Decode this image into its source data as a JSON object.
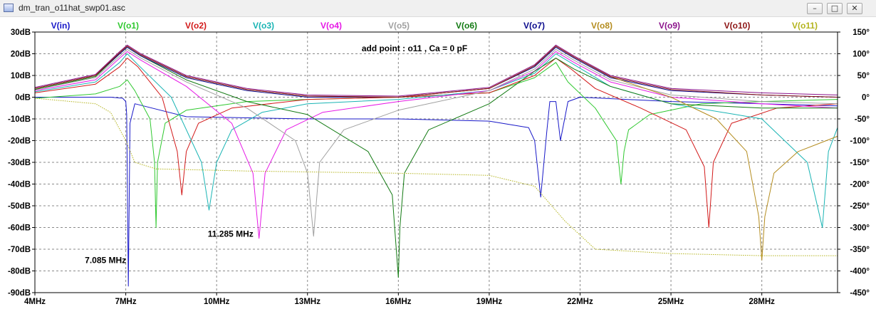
{
  "window": {
    "title": "dm_tran_o11hat_swp01.asc",
    "minimize_glyph": "–",
    "maximize_glyph": "□",
    "close_glyph": "✕"
  },
  "chart_data": {
    "type": "line",
    "annotation_title": "add point : o11 , Ca = 0 pF",
    "annotations": [
      {
        "text": "7.085 MHz",
        "x": 7.085,
        "y": -75
      },
      {
        "text": "11.285 MHz",
        "x": 11.285,
        "y": -63
      }
    ],
    "x_axis": {
      "min": 4,
      "max": 30.5,
      "unit": "MHz",
      "ticks": [
        4,
        7,
        10,
        13,
        16,
        19,
        22,
        25,
        28
      ],
      "tick_labels": [
        "4MHz",
        "7MHz",
        "10MHz",
        "13MHz",
        "16MHz",
        "19MHz",
        "22MHz",
        "25MHz",
        "28MHz"
      ]
    },
    "y_axis_left": {
      "min": -90,
      "max": 30,
      "unit": "dB",
      "ticks": [
        30,
        20,
        10,
        0,
        -10,
        -20,
        -30,
        -40,
        -50,
        -60,
        -70,
        -80,
        -90
      ],
      "tick_labels": [
        "30dB",
        "20dB",
        "10dB",
        "0dB",
        "-10dB",
        "-20dB",
        "-30dB",
        "-40dB",
        "-50dB",
        "-60dB",
        "-70dB",
        "-80dB",
        "-90dB"
      ]
    },
    "y_axis_right": {
      "min": -450,
      "max": 150,
      "unit": "°",
      "ticks": [
        150,
        100,
        50,
        0,
        -50,
        -100,
        -150,
        -200,
        -250,
        -300,
        -350,
        -400,
        -450
      ],
      "tick_labels": [
        "150°",
        "100°",
        "50°",
        "0°",
        "-50°",
        "-100°",
        "-150°",
        "-200°",
        "-250°",
        "-300°",
        "-350°",
        "-400°",
        "-450°"
      ]
    },
    "grid": true,
    "series": [
      {
        "name": "V(in)",
        "color": "#1818c8",
        "x": [
          4,
          6.5,
          6.9,
          7.0,
          7.03,
          7.085,
          7.14,
          7.3,
          9,
          13,
          16,
          19,
          20.3,
          20.5,
          20.7,
          20.9,
          21.0,
          21.2,
          21.35,
          21.6,
          22,
          25,
          28,
          30.5
        ],
        "y": [
          0,
          0,
          -0.5,
          -2,
          -8,
          -87,
          -12,
          -3,
          -9,
          -10,
          -10,
          -11,
          -14,
          -20,
          -46,
          -16,
          -2,
          -2,
          -20,
          -2,
          0,
          -2,
          -3,
          -4
        ]
      },
      {
        "name": "V(o1)",
        "color": "#2fc82f",
        "x": [
          4,
          6,
          6.8,
          7.05,
          7.3,
          7.8,
          7.95,
          8.0,
          8.05,
          8.3,
          9,
          11,
          13,
          16,
          19,
          20.5,
          21.2,
          21.6,
          22.5,
          23.2,
          23.35,
          23.45,
          23.6,
          24.3,
          26,
          28,
          30.5
        ],
        "y": [
          -0.5,
          1.5,
          5,
          8,
          3,
          -10,
          -30,
          -60,
          -30,
          -12,
          -6,
          -2,
          -1,
          0,
          2,
          9,
          16,
          7,
          -5,
          -20,
          -40,
          -25,
          -15,
          -8,
          -3,
          -2,
          -1
        ]
      },
      {
        "name": "V(o2)",
        "color": "#d21919",
        "x": [
          4,
          6,
          6.8,
          7.05,
          7.4,
          8.2,
          8.7,
          8.85,
          9.0,
          9.4,
          10.5,
          13,
          16,
          19,
          20.5,
          21.2,
          21.7,
          22.5,
          24,
          25.5,
          26.1,
          26.25,
          26.4,
          27,
          28.5,
          30.5
        ],
        "y": [
          2,
          6,
          14,
          18,
          14,
          0,
          -25,
          -45,
          -25,
          -12,
          -5,
          -1,
          0,
          2,
          10,
          18,
          13,
          4,
          -5,
          -15,
          -32,
          -60,
          -30,
          -12,
          -5,
          -3
        ]
      },
      {
        "name": "V(o3)",
        "color": "#19b4b4",
        "x": [
          4,
          6,
          6.8,
          7.05,
          7.4,
          8.5,
          9.5,
          9.75,
          10.0,
          10.5,
          11.5,
          13,
          16,
          19,
          20.5,
          21.2,
          21.8,
          23,
          25,
          28,
          29.5,
          30.0,
          30.2,
          30.5
        ],
        "y": [
          2.5,
          7,
          16,
          20,
          15,
          0,
          -30,
          -52,
          -30,
          -15,
          -7,
          -3,
          -1,
          3,
          11,
          20,
          15,
          5,
          -3,
          -10,
          -30,
          -60,
          -25,
          -14
        ]
      },
      {
        "name": "V(o4)",
        "color": "#e619e6",
        "x": [
          4,
          6,
          6.8,
          7.05,
          7.5,
          9,
          10.5,
          11.2,
          11.4,
          11.6,
          12.3,
          13.5,
          16,
          19,
          20.5,
          21.2,
          21.8,
          23,
          25,
          28,
          30.5
        ],
        "y": [
          3,
          8,
          18,
          21,
          17,
          5,
          -12,
          -35,
          -65,
          -35,
          -15,
          -7,
          -2,
          3,
          12,
          21,
          16,
          7,
          0,
          -3,
          -5
        ]
      },
      {
        "name": "V(o5)",
        "color": "#a0a0a0",
        "x": [
          4,
          6,
          6.8,
          7.05,
          7.5,
          9,
          11,
          12.6,
          13.0,
          13.2,
          13.4,
          14.2,
          16,
          19,
          20.5,
          21.2,
          21.8,
          23,
          25,
          28,
          30.5
        ],
        "y": [
          3.5,
          9,
          19,
          22,
          18,
          7,
          -5,
          -20,
          -35,
          -64,
          -30,
          -15,
          -6,
          3,
          13,
          22,
          17,
          8,
          1,
          -2,
          -3
        ]
      },
      {
        "name": "V(o6)",
        "color": "#127a12",
        "x": [
          4,
          6,
          6.8,
          7.05,
          7.5,
          9,
          11,
          13,
          15,
          15.8,
          16.0,
          16.05,
          16.2,
          17,
          19,
          20.5,
          21.2,
          21.8,
          23,
          25,
          28,
          30.5
        ],
        "y": [
          3.5,
          9.5,
          20,
          23,
          19,
          8,
          -2,
          -8,
          -25,
          -45,
          -83,
          -60,
          -35,
          -15,
          -3,
          12,
          18,
          13,
          5,
          -3,
          -5,
          -5
        ]
      },
      {
        "name": "V(o7)",
        "color": "#0a0a8c",
        "x": [
          4,
          6,
          6.8,
          7.05,
          7.5,
          9,
          11,
          13,
          16,
          19,
          20.5,
          21.2,
          21.8,
          23,
          25,
          28,
          30.5
        ],
        "y": [
          4,
          10,
          20,
          23,
          19,
          9,
          3,
          0,
          0,
          4,
          14,
          23,
          18,
          9,
          3,
          1,
          0
        ]
      },
      {
        "name": "V(o8)",
        "color": "#b48c1e",
        "x": [
          4,
          6,
          6.8,
          7.05,
          7.5,
          9,
          11,
          13,
          16,
          19,
          20.5,
          21.2,
          21.8,
          23,
          25,
          26.5,
          27.5,
          27.9,
          28.0,
          28.1,
          28.4,
          29.2,
          30.5
        ],
        "y": [
          4,
          10,
          21,
          23.5,
          19.5,
          9.5,
          3.5,
          0.5,
          0,
          4,
          14.5,
          23.5,
          18.5,
          9.5,
          0,
          -10,
          -25,
          -55,
          -75,
          -55,
          -35,
          -25,
          -18
        ]
      },
      {
        "name": "V(o9)",
        "color": "#8c148c",
        "x": [
          4,
          6,
          6.8,
          7.05,
          7.5,
          9,
          11,
          13,
          16,
          19,
          20.5,
          21.2,
          21.8,
          23,
          25,
          28,
          30.5
        ],
        "y": [
          4.5,
          10.5,
          21,
          24,
          20,
          10,
          4,
          1,
          0.5,
          4.5,
          15,
          24,
          19,
          10,
          4,
          2,
          1
        ]
      },
      {
        "name": "V(o10)",
        "color": "#8c1414",
        "x": [
          4,
          6,
          6.8,
          7.05,
          7.5,
          9,
          11,
          13,
          16,
          19,
          20.5,
          21.2,
          21.8,
          23,
          25,
          28,
          30.5
        ],
        "y": [
          4,
          10,
          20.5,
          23.5,
          19.5,
          9.5,
          3.5,
          0.5,
          0,
          4,
          14.5,
          23.5,
          18.5,
          9.5,
          3.5,
          1,
          0
        ]
      },
      {
        "name": "V(o11)",
        "color": "#b4b41e",
        "x": [
          4,
          6,
          6.5,
          7.0,
          7.3,
          8,
          11,
          16,
          19,
          20.5,
          21.5,
          22.5,
          25,
          28,
          30.5
        ],
        "y": [
          -0.5,
          -3,
          -7,
          -20,
          -30,
          -33,
          -34,
          -35,
          -36,
          -41,
          -57,
          -70,
          -72,
          -73,
          -73
        ]
      }
    ]
  }
}
